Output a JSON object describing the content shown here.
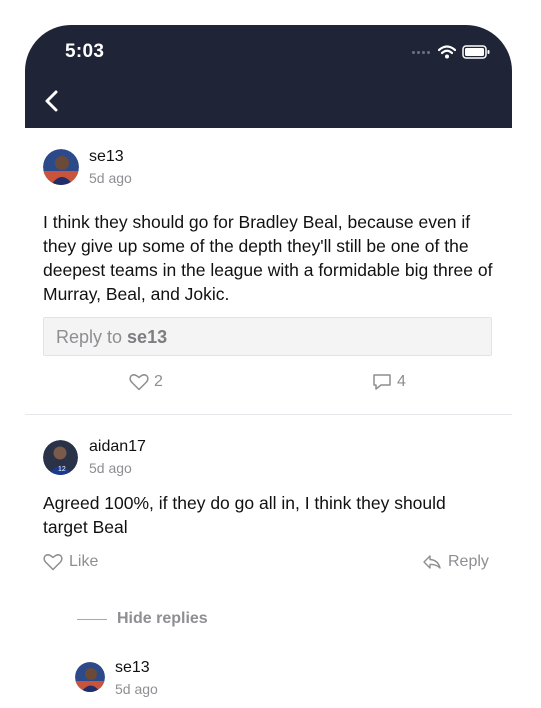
{
  "status_bar": {
    "time": "5:03"
  },
  "post": {
    "username": "se13",
    "ago": "5d ago",
    "text": "I think they should go for Bradley Beal, because even if they give up some of the depth they'll still be one of the deepest teams in the league with a formidable big three of Murray, Beal, and Jokic.",
    "reply_prefix": "Reply to ",
    "reply_user": "se13",
    "likes": "2",
    "comments": "4"
  },
  "comment": {
    "username": "aidan17",
    "ago": "5d ago",
    "text": "Agreed 100%, if they do go all in, I think they should target Beal",
    "like_label": "Like",
    "reply_label": "Reply",
    "hide_replies_label": "Hide replies"
  },
  "nested_reply": {
    "username": "se13",
    "ago": "5d ago"
  },
  "colors": {
    "header_bg": "#1f2437",
    "muted": "#8e8e93"
  }
}
